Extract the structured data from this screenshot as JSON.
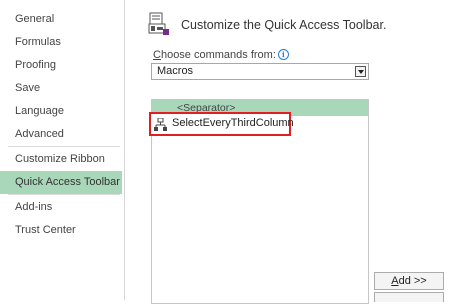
{
  "sidebar": {
    "items": [
      {
        "label": "General"
      },
      {
        "label": "Formulas"
      },
      {
        "label": "Proofing"
      },
      {
        "label": "Save"
      },
      {
        "label": "Language"
      },
      {
        "label": "Advanced"
      },
      {
        "label": "Customize Ribbon"
      },
      {
        "label": "Quick Access Toolbar"
      },
      {
        "label": "Add-ins"
      },
      {
        "label": "Trust Center"
      }
    ],
    "selected_label": "Quick Access Toolbar"
  },
  "main": {
    "title": "Customize the Quick Access Toolbar.",
    "title_icon": "quick-access-toolbar-icon",
    "choose_commands": {
      "label_hotkey": "C",
      "label_rest": "hoose commands from:",
      "info_icon": "info-icon",
      "selected_value": "Macros"
    },
    "commands_list": {
      "separator_label": "<Separator>",
      "macro_label": "SelectEveryThirdColumn",
      "macro_icon": "macro-icon"
    },
    "add_button": {
      "hotkey": "A",
      "rest": "dd >>"
    }
  },
  "colors": {
    "selection_highlight": "#a9d7b9",
    "callout_border": "#e02020",
    "info_blue": "#2b7cd3"
  }
}
